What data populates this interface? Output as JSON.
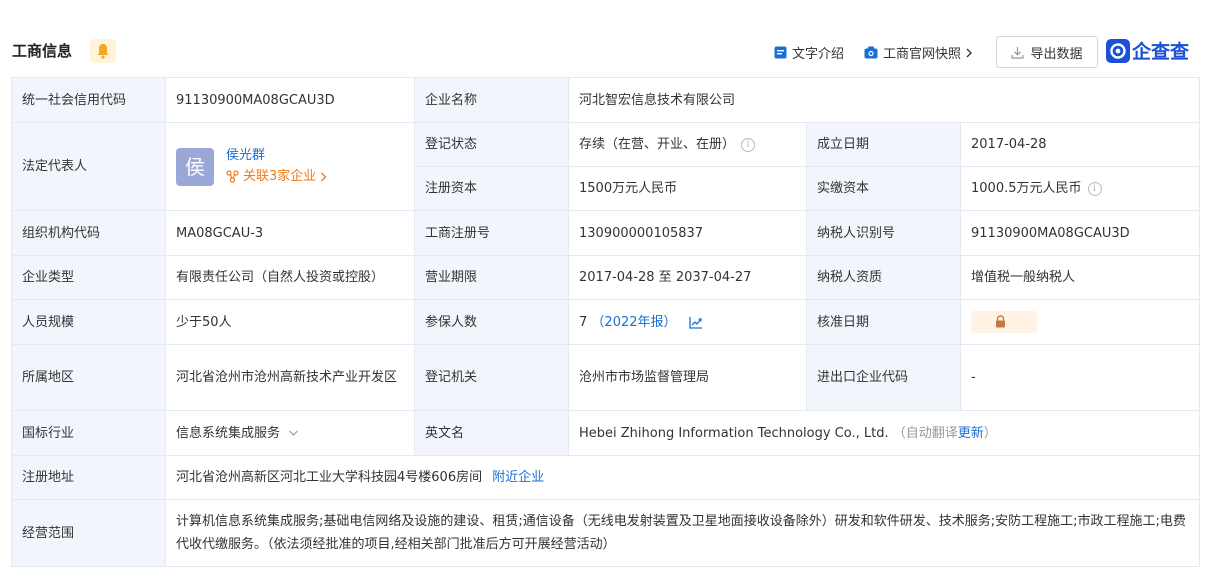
{
  "header": {
    "title": "工商信息",
    "text_intro": "文字介绍",
    "snapshot": "工商官网快照",
    "export": "导出数据",
    "logo": "企查查"
  },
  "rows": {
    "credit_code_label": "统一社会信用代码",
    "credit_code": "91130900MA08GCAU3D",
    "company_name_label": "企业名称",
    "company_name": "河北智宏信息技术有限公司",
    "legal_rep_label": "法定代表人",
    "legal_rep_avatar": "侯",
    "legal_rep_name": "侯光群",
    "legal_rep_link": "关联3家企业",
    "reg_status_label": "登记状态",
    "reg_status": "存续（在营、开业、在册）",
    "found_date_label": "成立日期",
    "found_date": "2017-04-28",
    "reg_capital_label": "注册资本",
    "reg_capital": "1500万元人民币",
    "paid_capital_label": "实缴资本",
    "paid_capital": "1000.5万元人民币",
    "org_code_label": "组织机构代码",
    "org_code": "MA08GCAU-3",
    "biz_reg_no_label": "工商注册号",
    "biz_reg_no": "130900000105837",
    "taxpayer_id_label": "纳税人识别号",
    "taxpayer_id": "91130900MA08GCAU3D",
    "company_type_label": "企业类型",
    "company_type": "有限责任公司（自然人投资或控股）",
    "biz_term_label": "营业期限",
    "biz_term": "2017-04-28 至 2037-04-27",
    "taxpayer_qual_label": "纳税人资质",
    "taxpayer_qual": "增值税一般纳税人",
    "staff_size_label": "人员规模",
    "staff_size": "少于50人",
    "insured_label": "参保人数",
    "insured": "7",
    "insured_year": "（2022年报）",
    "approval_date_label": "核准日期",
    "region_label": "所属地区",
    "region": "河北省沧州市沧州高新技术产业开发区",
    "reg_authority_label": "登记机关",
    "reg_authority": "沧州市市场监督管理局",
    "import_export_label": "进出口企业代码",
    "import_export": "-",
    "industry_label": "国标行业",
    "industry": "信息系统集成服务",
    "english_name_label": "英文名",
    "english_name": "Hebei Zhihong Information Technology Co., Ltd.",
    "auto_translate": "（自动翻译",
    "update": "更新",
    "auto_translate_end": "）",
    "reg_address_label": "注册地址",
    "reg_address": "河北省沧州高新区河北工业大学科技园4号楼606房间",
    "nearby": "附近企业",
    "scope_label": "经营范围",
    "scope": "计算机信息系统集成服务;基础电信网络及设施的建设、租赁;通信设备（无线电发射装置及卫星地面接收设备除外）研发和软件研发、技术服务;安防工程施工;市政工程施工;电费代收代缴服务。（依法须经批准的项目,经相关部门批准后方可开展经营活动）"
  },
  "colors": {
    "label_bg": "#f2f6fc",
    "border": "#e4eaf3",
    "link_blue": "#1a6fd6",
    "accent_orange": "#f07b1a",
    "logo_blue": "#1a4fd6"
  },
  "chart_data": {
    "type": "table",
    "title": "工商信息",
    "rows": [
      [
        "统一社会信用代码",
        "91130900MA08GCAU3D",
        "企业名称",
        "河北智宏信息技术有限公司"
      ],
      [
        "法定代表人",
        "侯光群",
        "登记状态",
        "存续（在营、开业、在册）",
        "成立日期",
        "2017-04-28"
      ],
      [
        "",
        "",
        "注册资本",
        "1500万元人民币",
        "实缴资本",
        "1000.5万元人民币"
      ],
      [
        "组织机构代码",
        "MA08GCAU-3",
        "工商注册号",
        "130900000105837",
        "纳税人识别号",
        "91130900MA08GCAU3D"
      ],
      [
        "企业类型",
        "有限责任公司（自然人投资或控股）",
        "营业期限",
        "2017-04-28 至 2037-04-27",
        "纳税人资质",
        "增值税一般纳税人"
      ],
      [
        "人员规模",
        "少于50人",
        "参保人数",
        "7",
        "核准日期",
        ""
      ],
      [
        "所属地区",
        "河北省沧州市沧州高新技术产业开发区",
        "登记机关",
        "沧州市市场监督管理局",
        "进出口企业代码",
        "-"
      ],
      [
        "国标行业",
        "信息系统集成服务",
        "英文名",
        "Hebei Zhihong Information Technology Co., Ltd."
      ],
      [
        "注册地址",
        "河北省沧州高新区河北工业大学科技园4号楼606房间"
      ],
      [
        "经营范围",
        "计算机信息系统集成服务;基础电信网络及设施的建设、租赁;通信设备（无线电发射装置及卫星地面接收设备除外）研发和软件研发、技术服务;安防工程施工;市政工程施工;电费代收代缴服务。（依法须经批准的项目,经相关部门批准后方可开展经营活动）"
      ]
    ]
  }
}
